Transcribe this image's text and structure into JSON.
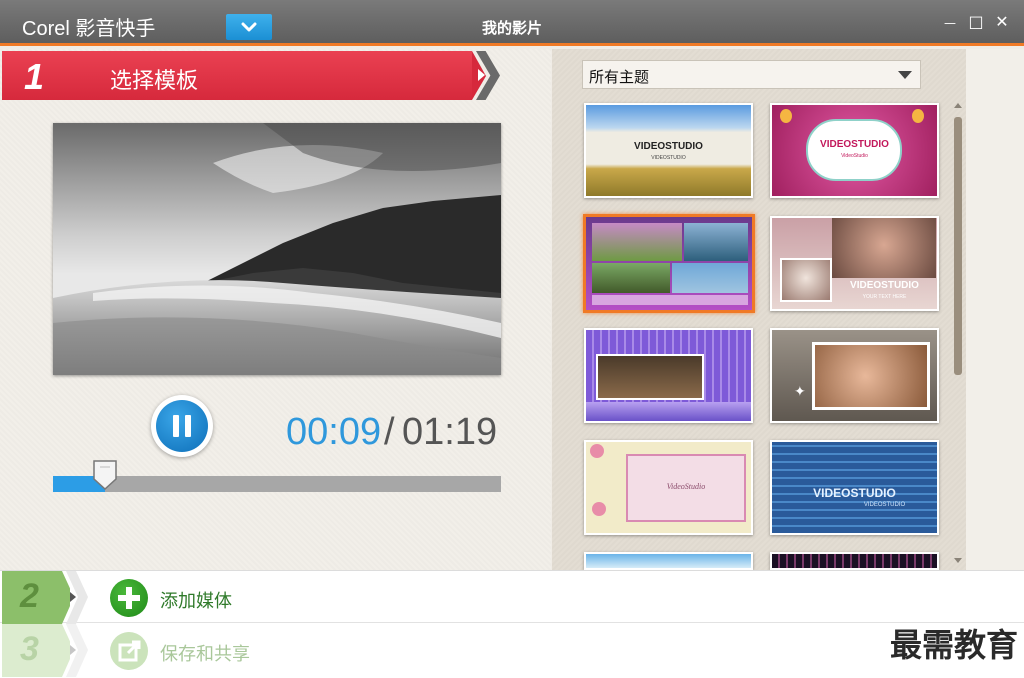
{
  "titlebar": {
    "app_name": "Corel 影音快手",
    "project_title": "我的影片",
    "minimize_label": "—",
    "maximize_label": "□",
    "close_label": "✕"
  },
  "step1": {
    "number": "1",
    "label": "选择模板"
  },
  "player": {
    "current_time": "00:09",
    "separator": "/",
    "total_time": "01:19",
    "progress_fraction": 0.116
  },
  "themes": {
    "selected_option": "所有主题",
    "thumbnails": [
      {
        "title": "VIDEOSTUDIO",
        "subtitle": "VIDEOSTUDIO"
      },
      {
        "title": "VIDEOSTUDIO",
        "subtitle": "VideoStudio"
      },
      {
        "title": "",
        "subtitle": ""
      },
      {
        "title": "VIDEOSTUDIO",
        "subtitle": "YOUR TEXT HERE"
      },
      {
        "title": "",
        "subtitle": ""
      },
      {
        "title": "",
        "subtitle": ""
      },
      {
        "title": "VideoStudio",
        "subtitle": ""
      },
      {
        "title": "VIDEOSTUDIO",
        "subtitle": "VIDEOSTUDIO"
      }
    ],
    "selected_index": 2
  },
  "step2": {
    "number": "2",
    "label": "添加媒体"
  },
  "step3": {
    "number": "3",
    "label": "保存和共享"
  },
  "watermark": "最需教育",
  "colors": {
    "accent_orange": "#f07a26",
    "step1_red": "#d6293c",
    "player_blue": "#2c9de6",
    "step2_green": "#8cbf6a",
    "step3_green": "#c9e0b9"
  }
}
